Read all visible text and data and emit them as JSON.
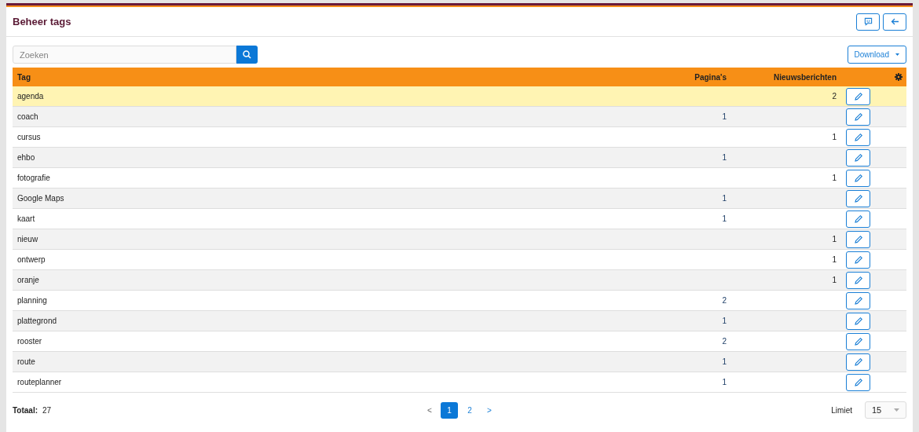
{
  "title": "Beheer tags",
  "search": {
    "placeholder": "Zoeken"
  },
  "download_button": "Download",
  "table": {
    "columns": [
      "Tag",
      "Pagina's",
      "Nieuwsberichten"
    ],
    "rows": [
      {
        "tag": "agenda",
        "paginas": "",
        "nieuws": "2",
        "highlighted": true
      },
      {
        "tag": "coach",
        "paginas": "1",
        "nieuws": "",
        "highlighted": false
      },
      {
        "tag": "cursus",
        "paginas": "",
        "nieuws": "1",
        "highlighted": false
      },
      {
        "tag": "ehbo",
        "paginas": "1",
        "nieuws": "",
        "highlighted": false
      },
      {
        "tag": "fotografie",
        "paginas": "",
        "nieuws": "1",
        "highlighted": false
      },
      {
        "tag": "Google Maps",
        "paginas": "1",
        "nieuws": "",
        "highlighted": false
      },
      {
        "tag": "kaart",
        "paginas": "1",
        "nieuws": "",
        "highlighted": false
      },
      {
        "tag": "nieuw",
        "paginas": "",
        "nieuws": "1",
        "highlighted": false
      },
      {
        "tag": "ontwerp",
        "paginas": "",
        "nieuws": "1",
        "highlighted": false
      },
      {
        "tag": "oranje",
        "paginas": "",
        "nieuws": "1",
        "highlighted": false
      },
      {
        "tag": "planning",
        "paginas": "2",
        "nieuws": "",
        "highlighted": false
      },
      {
        "tag": "plattegrond",
        "paginas": "1",
        "nieuws": "",
        "highlighted": false
      },
      {
        "tag": "rooster",
        "paginas": "2",
        "nieuws": "",
        "highlighted": false
      },
      {
        "tag": "route",
        "paginas": "1",
        "nieuws": "",
        "highlighted": false
      },
      {
        "tag": "routeplanner",
        "paginas": "1",
        "nieuws": "",
        "highlighted": false
      }
    ]
  },
  "footer": {
    "total_label": "Totaal:",
    "total": "27",
    "pagination": {
      "prev": "<",
      "next": ">",
      "pages": [
        {
          "label": "1",
          "selected": true
        },
        {
          "label": "2",
          "selected": false
        }
      ]
    },
    "limit_label": "Limiet",
    "limit": "15"
  }
}
